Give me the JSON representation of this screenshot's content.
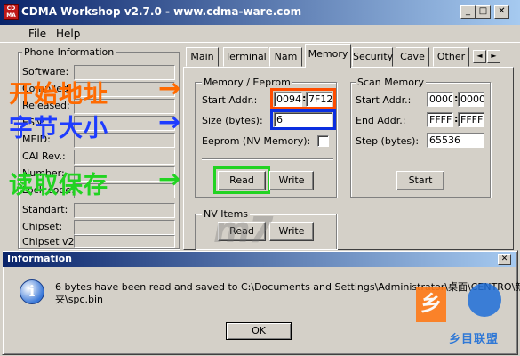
{
  "window": {
    "title": "CDMA Workshop v2.7.0  -  www.cdma-ware.com",
    "logo_text": "CD MA",
    "min_glyph": "_",
    "max_glyph": "□",
    "close_glyph": "✕"
  },
  "menu": [
    "File",
    "Help"
  ],
  "phone_info": {
    "title": "Phone Information",
    "fields": [
      "Software:",
      "Compiled:",
      "Released:",
      "ESN:",
      "MEID:",
      "CAI Rev.:",
      "Number:",
      "Lock code:"
    ],
    "fields2": [
      "Standart:",
      "Chipset:",
      "Chipset v2:"
    ]
  },
  "tabs": [
    "Main",
    "Terminal",
    "Nam",
    "Memory",
    "Security",
    "Cave",
    "Other"
  ],
  "active_tab": "Memory",
  "tab_scroll": {
    "left": "◄",
    "right": "►"
  },
  "memory": {
    "title": "Memory / Eeprom",
    "start_label": "Start Addr.:",
    "start_hi": "0094",
    "start_lo": "7F12",
    "size_label": "Size (bytes):",
    "size_value": "6",
    "eeprom_label": "Eeprom (NV Memory):",
    "read": "Read",
    "write": "Write"
  },
  "scan": {
    "title": "Scan Memory",
    "start_label": "Start Addr.:",
    "start_hi": "0000",
    "start_lo": "0000",
    "end_label": "End Addr.:",
    "end_hi": "FFFF",
    "end_lo": "FFFF",
    "step_label": "Step (bytes):",
    "step_value": "65536",
    "start_btn": "Start"
  },
  "nv_items": {
    "title": "NV Items",
    "read": "Read",
    "write": "Write"
  },
  "annotations": {
    "start_addr": "开始地址",
    "byte_size": "字节大小",
    "read_save": "读取保存",
    "arrow": "→"
  },
  "dialog": {
    "title": "Information",
    "message_line1": "6 bytes have been read and saved to C:\\Documents and Settings\\Administrator\\桌面\\CENTRO\\新",
    "message_line2": "夹\\spc.bin",
    "ok": "OK",
    "close_glyph": "✕",
    "info_glyph": "i"
  },
  "watermark": {
    "text": "m7",
    "brand": "乡目联盟",
    "brand_mark": "乡"
  },
  "colors": {
    "annotation_orange": "#ff6a00",
    "annotation_blue": "#1e3cff",
    "annotation_green": "#22d322",
    "title_blue": "#0a246a",
    "highlight_orange": "#ff4d00",
    "highlight_blue": "#0b2fe0",
    "highlight_green": "#22d322"
  }
}
